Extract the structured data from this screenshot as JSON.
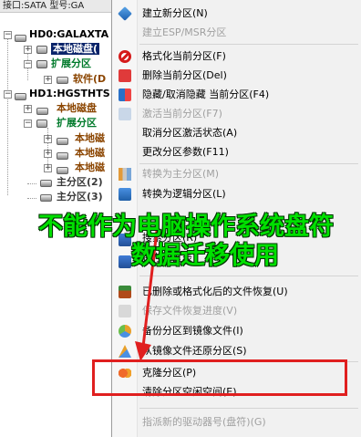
{
  "tree": {
    "topbar_text": "接口:SATA  型号:GA",
    "disk0_label": "HD0:GALAXTA",
    "disk0_local": "本地磁盘(",
    "disk0_ext": "扩展分区",
    "disk0_soft": "软件(D",
    "disk1_label": "HD1:HGSTHTS",
    "disk1_local": "本地磁盘",
    "disk1_ext": "扩展分区",
    "disk1_sub1": "本地磁",
    "disk1_sub2": "本地磁",
    "disk1_sub3": "本地磁",
    "primary2": "主分区(2)",
    "primary3": "主分区(3)"
  },
  "menu": {
    "items": [
      {
        "label": "建立新分区(N)",
        "icon": "new-partition-icon",
        "disabled": false
      },
      {
        "label": "建立ESP/MSR分区",
        "icon": "",
        "disabled": true
      },
      {
        "label": "格式化当前分区(F)",
        "icon": "format-icon",
        "disabled": false
      },
      {
        "label": "删除当前分区(Del)",
        "icon": "delete-icon",
        "disabled": false
      },
      {
        "label": "隐藏/取消隐藏 当前分区(F4)",
        "icon": "hide-icon",
        "disabled": false
      },
      {
        "label": "激活当前分区(F7)",
        "icon": "activate-icon",
        "disabled": true
      },
      {
        "label": "取消分区激活状态(A)",
        "icon": "",
        "disabled": false
      },
      {
        "label": "更改分区参数(F11)",
        "icon": "",
        "disabled": false
      },
      {
        "label": "转换为主分区(M)",
        "icon": "convert-primary-icon",
        "disabled": true
      },
      {
        "label": "转换为逻辑分区(L)",
        "icon": "convert-logical-icon",
        "disabled": false
      },
      {
        "label": "已删除或格式化后的文件恢复(U)",
        "icon": "file-recovery-icon",
        "disabled": false
      },
      {
        "label": "保存文件恢复进度(V)",
        "icon": "save-progress-icon",
        "disabled": true
      },
      {
        "label": "备份分区到镜像文件(I)",
        "icon": "backup-icon",
        "disabled": false
      },
      {
        "label": "从镜像文件还原分区(S)",
        "icon": "restore-icon",
        "disabled": false
      },
      {
        "label": "克隆分区(P)",
        "icon": "clone-icon",
        "disabled": false
      },
      {
        "label": "清除分区空闲空间(E)",
        "icon": "",
        "disabled": false
      },
      {
        "label": "指派新的驱动器号(盘符)(G)",
        "icon": "",
        "disabled": true
      }
    ],
    "partial_a": "搜索分区(R)",
    "partial_b": "保存分区表"
  },
  "overlay": {
    "line1": "不能作为电脑操作系统盘符",
    "line2": "数据迁移使用"
  },
  "colors": {
    "overlay_text": "#00e000",
    "highlight_box": "#e01f1f",
    "selection": "#0a246a"
  }
}
